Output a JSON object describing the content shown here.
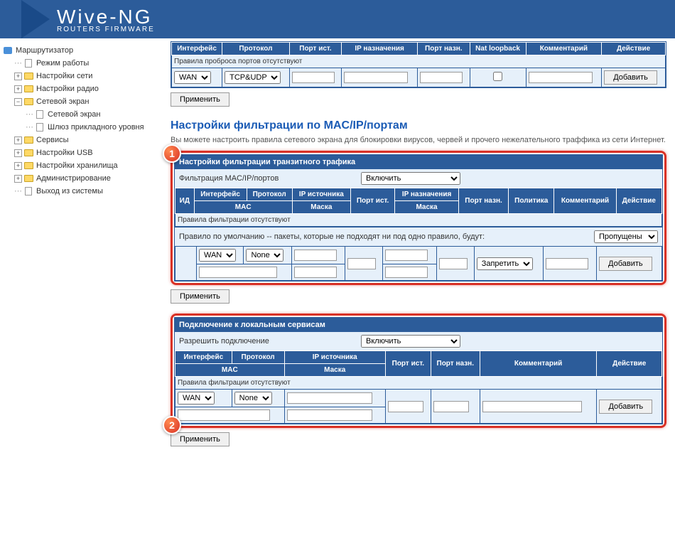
{
  "brand": {
    "name": "Wive-NG",
    "subtitle": "ROUTERS FIRMWARE"
  },
  "sidebar": {
    "router": "Маршрутизатор",
    "mode": "Режим работы",
    "net": "Настройки сети",
    "radio": "Настройки радио",
    "firewall": "Сетевой экран",
    "firewall_sub": "Сетевой экран",
    "alg": "Шлюз прикладного уровня",
    "services": "Сервисы",
    "usb": "Настройки USB",
    "storage": "Настройки хранилища",
    "admin": "Администрирование",
    "logout": "Выход из системы"
  },
  "portfw": {
    "h_iface": "Интерфейс",
    "h_proto": "Протокол",
    "h_srcport": "Порт ист.",
    "h_dstip": "IP назначения",
    "h_dstport": "Порт назн.",
    "h_nat": "Nat loopback",
    "h_comment": "Комментарий",
    "h_action": "Действие",
    "empty": "Правила проброса портов отсутствуют",
    "iface_sel": "WAN",
    "proto_sel": "TCP&UDP",
    "add": "Добавить",
    "apply": "Применить"
  },
  "filter": {
    "title": "Настройки фильтрации по MAC/IP/портам",
    "desc": "Вы можете настроить правила сетевого экрана для блокировки вирусов, червей и прочего нежелательного траффика из сети Интернет.",
    "transit_title": "Настройки фильтрации транзитного трафика",
    "filter_label": "Фильтрация MAC/IP/портов",
    "enable": "Включить",
    "h_id": "ИД",
    "h_iface": "Интерфейс",
    "h_proto": "Протокол",
    "h_srcip": "IP источника",
    "h_srcport": "Порт ист.",
    "h_dstip": "IP назначения",
    "h_dstport": "Порт назн.",
    "h_policy": "Политика",
    "h_comment": "Комментарий",
    "h_action": "Действие",
    "h_mac": "MAC",
    "h_mask": "Маска",
    "empty": "Правила фильтрации отсутствуют",
    "default_rule": "Правило по умолчанию -- пакеты, которые не подходят ни под одно правило, будут:",
    "passed": "Пропущены",
    "iface_sel": "WAN",
    "proto_sel": "None",
    "policy_sel": "Запретить",
    "add": "Добавить",
    "apply": "Применить"
  },
  "local": {
    "title": "Подключение к локальным сервисам",
    "allow_label": "Разрешить подключение",
    "enable": "Включить",
    "h_iface": "Интерфейс",
    "h_proto": "Протокол",
    "h_srcip": "IP источника",
    "h_srcport": "Порт ист.",
    "h_dstport": "Порт назн.",
    "h_comment": "Комментарий",
    "h_action": "Действие",
    "h_mac": "MAC",
    "h_mask": "Маска",
    "empty": "Правила фильтрации отсутствуют",
    "iface_sel": "WAN",
    "proto_sel": "None",
    "add": "Добавить",
    "apply": "Применить"
  },
  "callouts": {
    "one": "1",
    "two": "2"
  }
}
